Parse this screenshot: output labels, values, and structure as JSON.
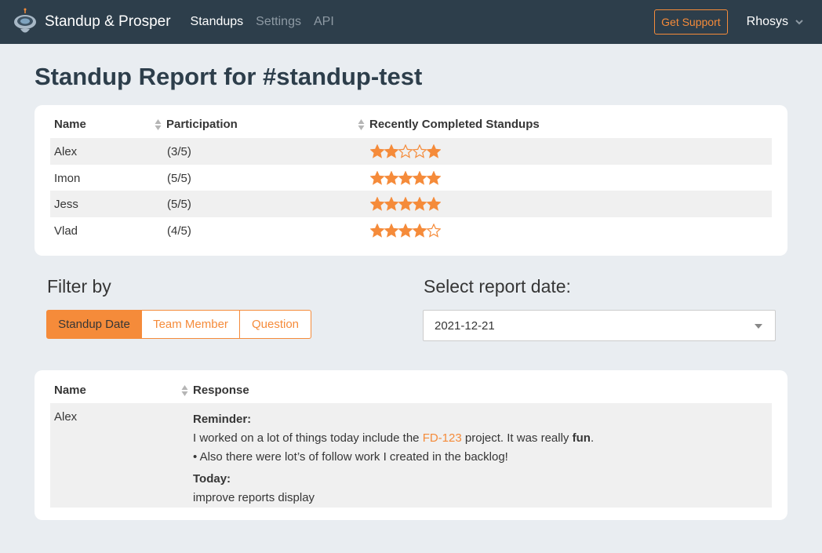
{
  "nav": {
    "brand": "Standup & Prosper",
    "links": [
      "Standups",
      "Settings",
      "API"
    ],
    "support_label": "Get Support",
    "user": "Rhosys"
  },
  "title": "Standup Report for #standup-test",
  "participation": {
    "headers": [
      "Name",
      "Participation",
      "Recently Completed Standups"
    ],
    "rows": [
      {
        "name": "Alex",
        "participation": "(3/5)",
        "stars": [
          1,
          1,
          0,
          0,
          1
        ]
      },
      {
        "name": "Imon",
        "participation": "(5/5)",
        "stars": [
          1,
          1,
          1,
          1,
          1
        ]
      },
      {
        "name": "Jess",
        "participation": "(5/5)",
        "stars": [
          1,
          1,
          1,
          1,
          1
        ]
      },
      {
        "name": "Vlad",
        "participation": "(4/5)",
        "stars": [
          1,
          1,
          1,
          1,
          0
        ]
      }
    ]
  },
  "filter": {
    "label": "Filter by",
    "options": [
      "Standup Date",
      "Team Member",
      "Question"
    ],
    "selected": "Standup Date"
  },
  "report_date": {
    "label": "Select report date:",
    "value": "2021-12-21"
  },
  "responses": {
    "headers": [
      "Name",
      "Response"
    ],
    "rows": [
      {
        "name": "Alex",
        "q1": "Reminder:",
        "a1_pre": "I worked on a lot of things today include the ",
        "a1_link": "FD-123",
        "a1_mid": " project. It was really ",
        "a1_bold": "fun",
        "a1_end": ".",
        "a1_bullet": "• Also there were lot’s of follow work I created in the backlog!",
        "q2": "Today:",
        "a2": "improve reports display"
      }
    ]
  },
  "colors": {
    "accent": "#f58b3a",
    "navbar": "#2d3e4b",
    "background": "#e9edf1"
  }
}
